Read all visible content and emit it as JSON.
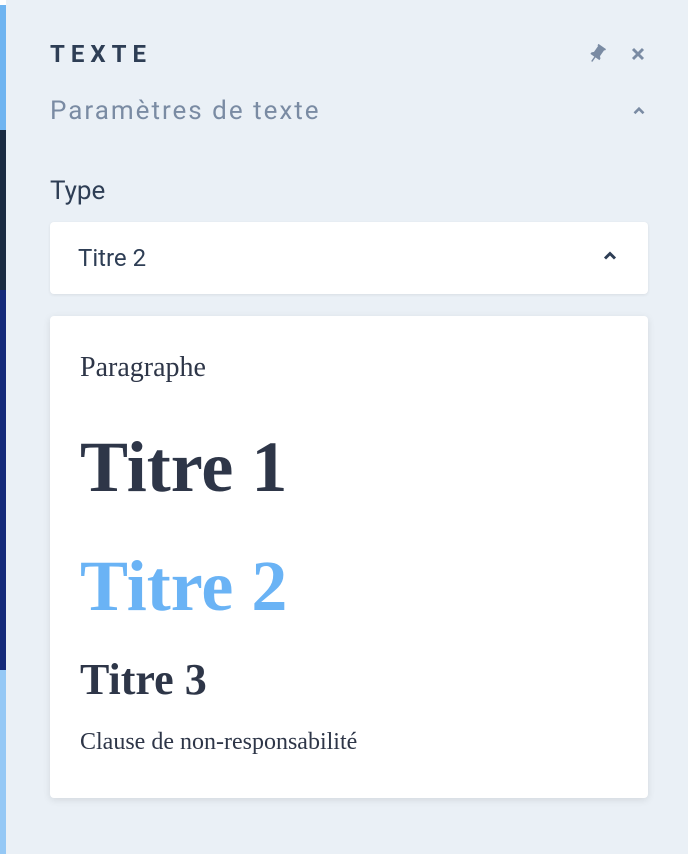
{
  "panel": {
    "title": "TEXTE"
  },
  "section": {
    "title": "Paramètres de texte"
  },
  "field": {
    "type_label": "Type",
    "selected_value": "Titre 2"
  },
  "options": {
    "paragraph": "Paragraphe",
    "titre1": "Titre 1",
    "titre2": "Titre 2",
    "titre3": "Titre 3",
    "disclaimer": "Clause de non-responsabilité"
  }
}
